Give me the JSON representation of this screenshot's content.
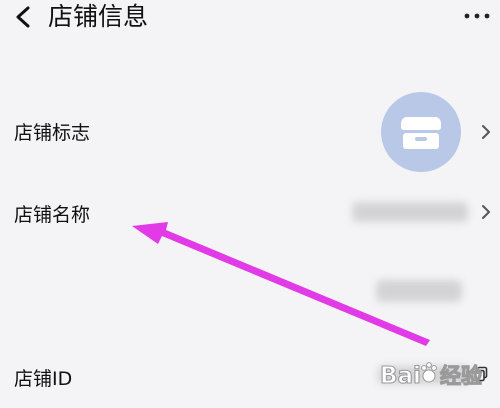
{
  "header": {
    "title": "店铺信息",
    "back_icon": "chevron-left-icon",
    "more_icon": "more-dots-icon"
  },
  "rows": [
    {
      "label": "店铺标志",
      "value_type": "avatar",
      "icon": "store-icon"
    },
    {
      "label": "店铺名称",
      "value_type": "blurred"
    },
    {
      "label": "",
      "value_type": "blurred"
    },
    {
      "label": "店铺ID",
      "value_type": "blurred",
      "icon": "copy-icon"
    }
  ],
  "colors": {
    "background": "#f4f4f6",
    "avatar_bg": "#b9c8e7",
    "annotation_arrow": "#e23ae6"
  },
  "watermark": {
    "text": "Bai",
    "text2": "经验"
  }
}
